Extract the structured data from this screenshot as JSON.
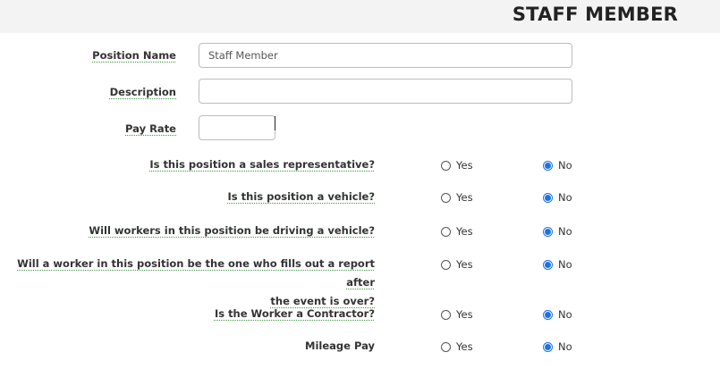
{
  "header": {
    "title": "STAFF MEMBER"
  },
  "fields": {
    "position_name": {
      "label": "Position Name",
      "value": "Staff Member"
    },
    "description": {
      "label": "Description",
      "value": ""
    },
    "pay_rate": {
      "label": "Pay Rate",
      "value": ""
    }
  },
  "questions": [
    {
      "text": "Is this position a sales representative?",
      "yes_label": "Yes",
      "no_label": "No",
      "selected": "No"
    },
    {
      "text": "Is this position a vehicle?",
      "yes_label": "Yes",
      "no_label": "No",
      "selected": "No"
    },
    {
      "text": "Will workers in this position be driving a vehicle?",
      "yes_label": "Yes",
      "no_label": "No",
      "selected": "No"
    },
    {
      "text_line1": "Will a worker in this position be the one who fills out a report after",
      "text_line2": "the event is over?",
      "yes_label": "Yes",
      "no_label": "No",
      "selected": "No"
    },
    {
      "text": "Is the Worker a Contractor?",
      "yes_label": "Yes",
      "no_label": "No",
      "selected": "No"
    },
    {
      "text": "Mileage Pay",
      "yes_label": "Yes",
      "no_label": "No",
      "selected": "No"
    }
  ],
  "colors": {
    "radio_selected": "#1a73e8",
    "header_bg": "#f3f3f3"
  }
}
